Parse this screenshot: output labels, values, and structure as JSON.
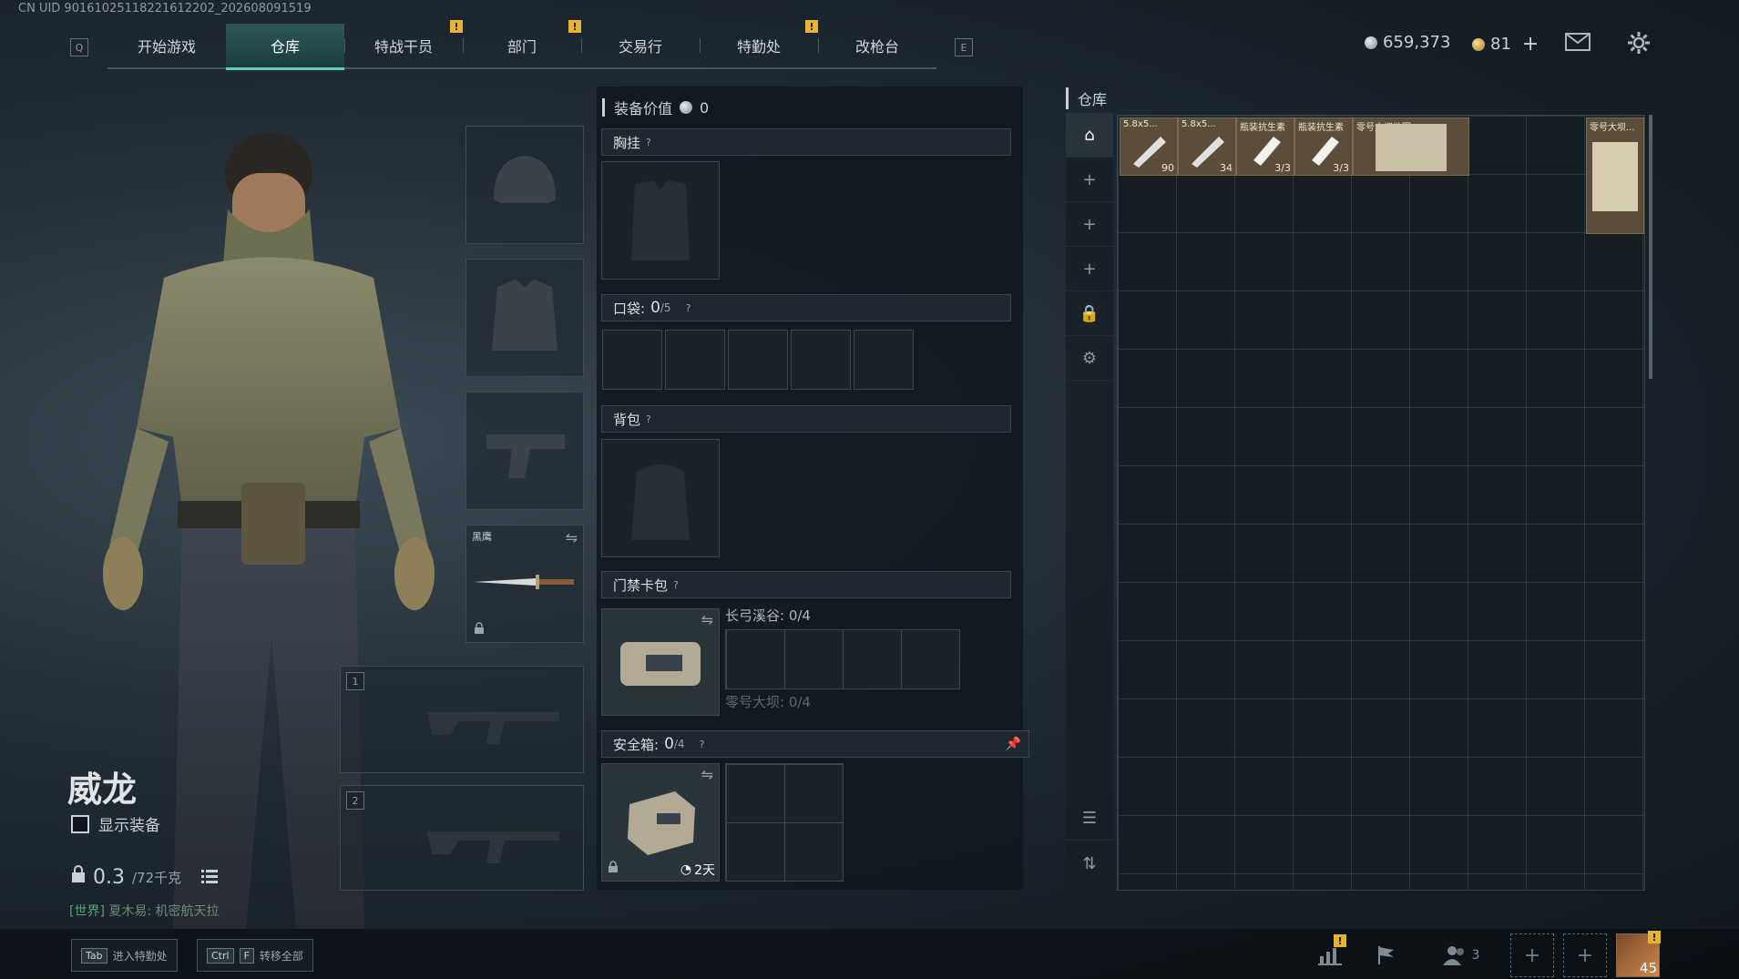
{
  "uid": "CN UID 90161025118221612202_202608091519",
  "nav": {
    "left_key": "Q",
    "right_key": "E",
    "tabs": [
      {
        "label": "开始游戏",
        "alert": false
      },
      {
        "label": "仓库",
        "alert": false,
        "active": true
      },
      {
        "label": "特战干员",
        "alert": true
      },
      {
        "label": "部门",
        "alert": true
      },
      {
        "label": "交易行",
        "alert": false
      },
      {
        "label": "特勤处",
        "alert": true
      },
      {
        "label": "改枪台",
        "alert": false
      }
    ],
    "alert_mark": "!"
  },
  "currency": {
    "silver": "659,373",
    "gold": "81",
    "gold_add": "+"
  },
  "character": {
    "name": "威龙",
    "show_equipment": "显示装备",
    "weight_current": "0.3",
    "weight_max": "/72千克",
    "world_tag": "[世界]",
    "world_msg": "夏木易: 机密航天拉"
  },
  "slots": {
    "melee_label": "黑鹰",
    "weapon1_num": "1",
    "weapon2_num": "2"
  },
  "equipment": {
    "value_label": "装备价值",
    "value": "0",
    "chest_rig": "胸挂",
    "pockets_label": "口袋:",
    "pockets_count": "0",
    "pockets_cap": "/5",
    "backpack": "背包",
    "keycard_label": "门禁卡包",
    "keycard_line1": "长弓溪谷: 0/4",
    "keycard_line2": "零号大坝: 0/4",
    "safebox_label": "安全箱:",
    "safebox_count": "0",
    "safebox_cap": "/4",
    "safebox_time": "2天",
    "help": "?"
  },
  "warehouse": {
    "title": "仓库",
    "items": [
      {
        "name": "5.8x5...",
        "count": "90"
      },
      {
        "name": "5.8x5...",
        "count": "34"
      },
      {
        "name": "瓶装抗生素",
        "count": "3/3"
      },
      {
        "name": "瓶装抗生素",
        "count": "3/3"
      },
      {
        "name": "零号大坝地图",
        "count": ""
      },
      {
        "name": "零号大坝...",
        "count": ""
      }
    ]
  },
  "bottom": {
    "hint1_key": "Tab",
    "hint1_text": "进入特勤处",
    "hint2_key1": "Ctrl",
    "hint2_key2": "F",
    "hint2_text": "转移全部",
    "friends_count": "3",
    "level": "45"
  }
}
